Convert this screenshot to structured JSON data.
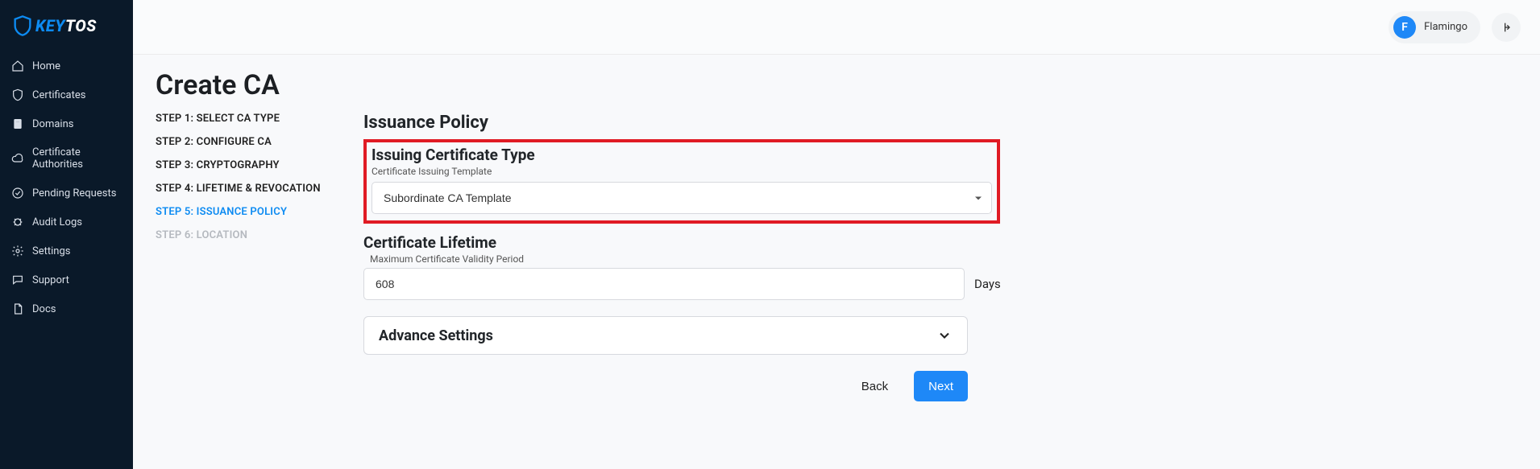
{
  "brand": {
    "prefix": "KEY",
    "suffix": "TOS"
  },
  "nav": {
    "home": "Home",
    "certificates": "Certificates",
    "domains": "Domains",
    "cas": "Certificate Authorities",
    "pending": "Pending Requests",
    "audit": "Audit Logs",
    "settings": "Settings",
    "support": "Support",
    "docs": "Docs"
  },
  "user": {
    "initial": "F",
    "name": "Flamingo"
  },
  "page": {
    "title": "Create CA"
  },
  "steps": {
    "s1": "STEP 1: SELECT CA TYPE",
    "s2": "STEP 2: CONFIGURE CA",
    "s3": "STEP 3: CRYPTOGRAPHY",
    "s4": "STEP 4: LIFETIME & REVOCATION",
    "s5": "STEP 5: ISSUANCE POLICY",
    "s6": "STEP 6: LOCATION"
  },
  "issuance": {
    "heading": "Issuance Policy",
    "cert_type_heading": "Issuing Certificate Type",
    "template_label": "Certificate Issuing Template",
    "template_value": "Subordinate CA Template",
    "lifetime_heading": "Certificate Lifetime",
    "validity_label": "Maximum Certificate Validity Period",
    "validity_value": "608",
    "validity_unit": "Days",
    "advanced_heading": "Advance Settings"
  },
  "buttons": {
    "back": "Back",
    "next": "Next"
  }
}
